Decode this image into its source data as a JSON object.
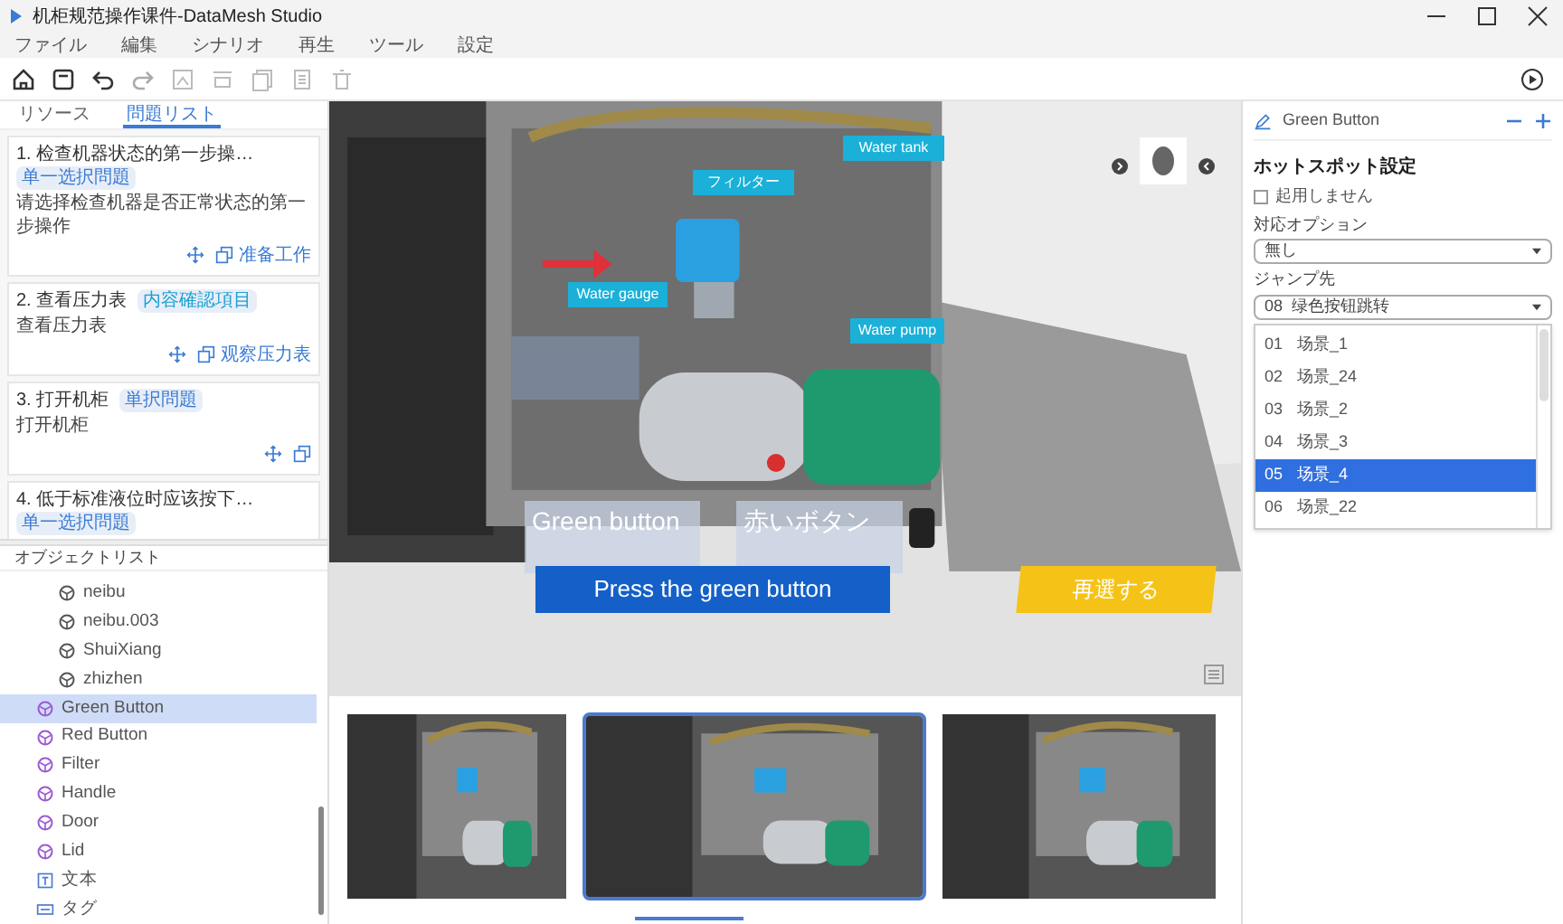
{
  "window": {
    "title": "机柜规范操作课件-DataMesh Studio"
  },
  "menu": [
    "ファイル",
    "編集",
    "シナリオ",
    "再生",
    "ツール",
    "設定"
  ],
  "left_tabs": [
    {
      "label": "リソース",
      "selected": false
    },
    {
      "label": "問題リスト",
      "selected": true
    }
  ],
  "questions": [
    {
      "title": "1. 检查机器状态的第一步操…",
      "tag": "单一选択問題",
      "color": "#3a7bd5",
      "description": "请选择检查机器是否正常状态的第一步操作",
      "link": "准备工作"
    },
    {
      "title": "2. 查看压力表",
      "tag": "内容確認項目",
      "color": "#1aa0d0",
      "description": "查看压力表",
      "link": "观察压力表"
    },
    {
      "title": "3. 打开机柜",
      "tag": "単択問題",
      "color": "#3a7bd5",
      "description": "打开机柜"
    },
    {
      "title": "4. 低于标准液位时应该按下…",
      "tag": "单一选択問題",
      "color": "#3a7bd5"
    }
  ],
  "object_list": {
    "title": "オブジェクトリスト",
    "items": [
      {
        "label": "neibu",
        "kind": "part",
        "selected": false
      },
      {
        "label": "neibu.003",
        "kind": "part",
        "selected": false
      },
      {
        "label": "ShuiXiang",
        "kind": "part",
        "selected": false
      },
      {
        "label": "zhizhen",
        "kind": "part",
        "selected": false
      },
      {
        "label": "Green Button",
        "kind": "object",
        "selected": true
      },
      {
        "label": "Red Button",
        "kind": "object",
        "selected": false
      },
      {
        "label": "Filter",
        "kind": "object",
        "selected": false
      },
      {
        "label": "Handle",
        "kind": "object",
        "selected": false
      },
      {
        "label": "Door",
        "kind": "object",
        "selected": false
      },
      {
        "label": "Lid",
        "kind": "object",
        "selected": false
      },
      {
        "label": "文本",
        "kind": "text",
        "selected": false
      },
      {
        "label": "タグ",
        "kind": "tag",
        "selected": false
      }
    ]
  },
  "viewport": {
    "labels": [
      {
        "text": "Water tank",
        "kind": "callout"
      },
      {
        "text": "フィルター",
        "kind": "callout"
      },
      {
        "text": "Water gauge",
        "kind": "callout"
      },
      {
        "text": "Water pump",
        "kind": "callout"
      },
      {
        "text": "Green button",
        "kind": "glass"
      },
      {
        "text": "赤いボタン",
        "kind": "glass"
      },
      {
        "text": "Press the green button",
        "kind": "banner"
      },
      {
        "text": "再選する",
        "kind": "action"
      }
    ]
  },
  "thumbnails": [
    {
      "kind": "picture",
      "selected": false
    },
    {
      "kind": "picture",
      "selected": true
    },
    {
      "kind": "picture",
      "selected": false
    }
  ],
  "properties": {
    "object_name": "Green Button",
    "section": "ホットスポット設定",
    "disable_checkbox": {
      "label": "起用しません",
      "checked": false
    },
    "option_label": "対応オプション",
    "option_value": "無し",
    "jump_label": "ジャンプ先",
    "jump_value": "08  绿色按钮跳转",
    "jump_options": [
      {
        "number": "01",
        "label": "场景_1",
        "selected": false
      },
      {
        "number": "02",
        "label": "场景_24",
        "selected": false
      },
      {
        "number": "03",
        "label": "场景_2",
        "selected": false
      },
      {
        "number": "04",
        "label": "场景_3",
        "selected": false
      },
      {
        "number": "05",
        "label": "场景_4",
        "selected": true
      },
      {
        "number": "06",
        "label": "场景_22",
        "selected": false
      }
    ]
  }
}
